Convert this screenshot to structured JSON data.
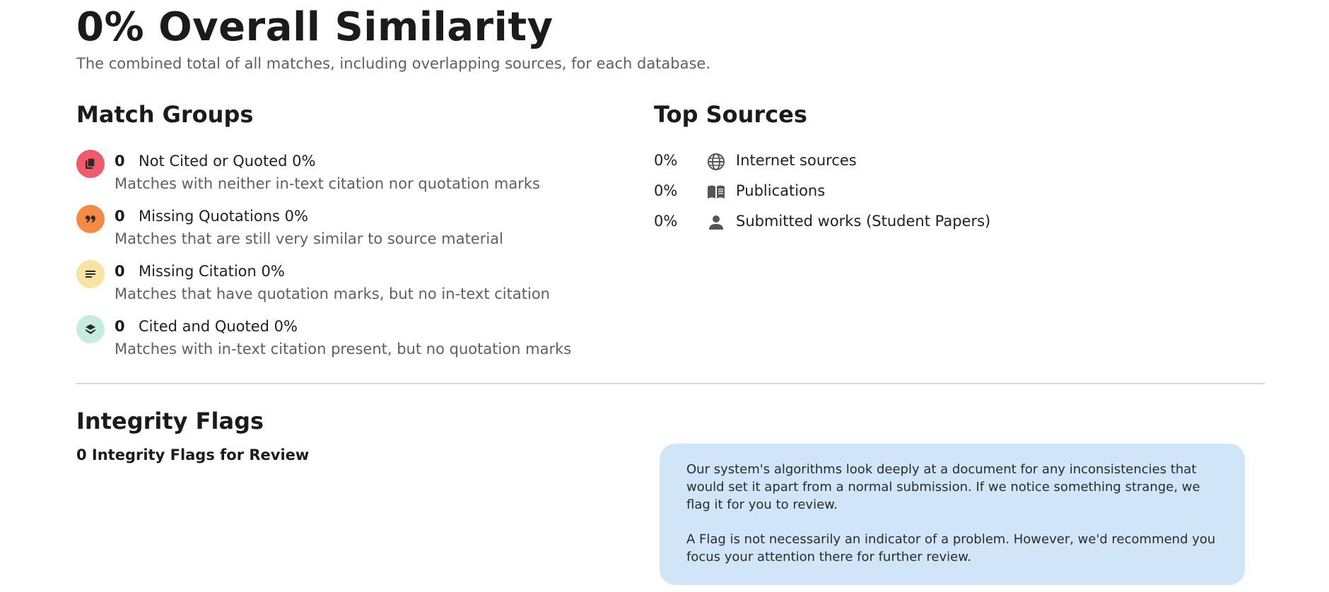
{
  "header": {
    "title": "0% Overall Similarity",
    "subtitle": "The combined total of all matches, including overlapping sources, for each database."
  },
  "match_groups": {
    "heading": "Match Groups",
    "items": [
      {
        "count": "0",
        "label": "Not Cited or Quoted 0%",
        "description": "Matches with neither in-text citation nor quotation marks",
        "icon": "copy-icon",
        "color": "#f05a6a"
      },
      {
        "count": "0",
        "label": "Missing Quotations 0%",
        "description": "Matches that are still very similar to source material",
        "icon": "quote-icon",
        "color": "#f58a45"
      },
      {
        "count": "0",
        "label": "Missing Citation 0%",
        "description": "Matches that have quotation marks, but no in-text citation",
        "icon": "lines-icon",
        "color": "#f8e3a3"
      },
      {
        "count": "0",
        "label": "Cited and Quoted 0%",
        "description": "Matches with in-text citation present, but no quotation marks",
        "icon": "stack-icon",
        "color": "#c6ecdf"
      }
    ]
  },
  "top_sources": {
    "heading": "Top Sources",
    "items": [
      {
        "percent": "0%",
        "label": "Internet sources",
        "icon": "globe-icon"
      },
      {
        "percent": "0%",
        "label": "Publications",
        "icon": "book-icon"
      },
      {
        "percent": "0%",
        "label": "Submitted works (Student Papers)",
        "icon": "person-icon"
      }
    ]
  },
  "integrity_flags": {
    "heading": "Integrity Flags",
    "summary": "0 Integrity Flags for Review",
    "info_paragraph_1": "Our system's algorithms look deeply at a document for any inconsistencies that would set it apart from a normal submission. If we notice something strange, we flag it for you to review.",
    "info_paragraph_2": "A Flag is not necessarily an indicator of a problem. However, we'd recommend you focus your attention there for further review."
  }
}
